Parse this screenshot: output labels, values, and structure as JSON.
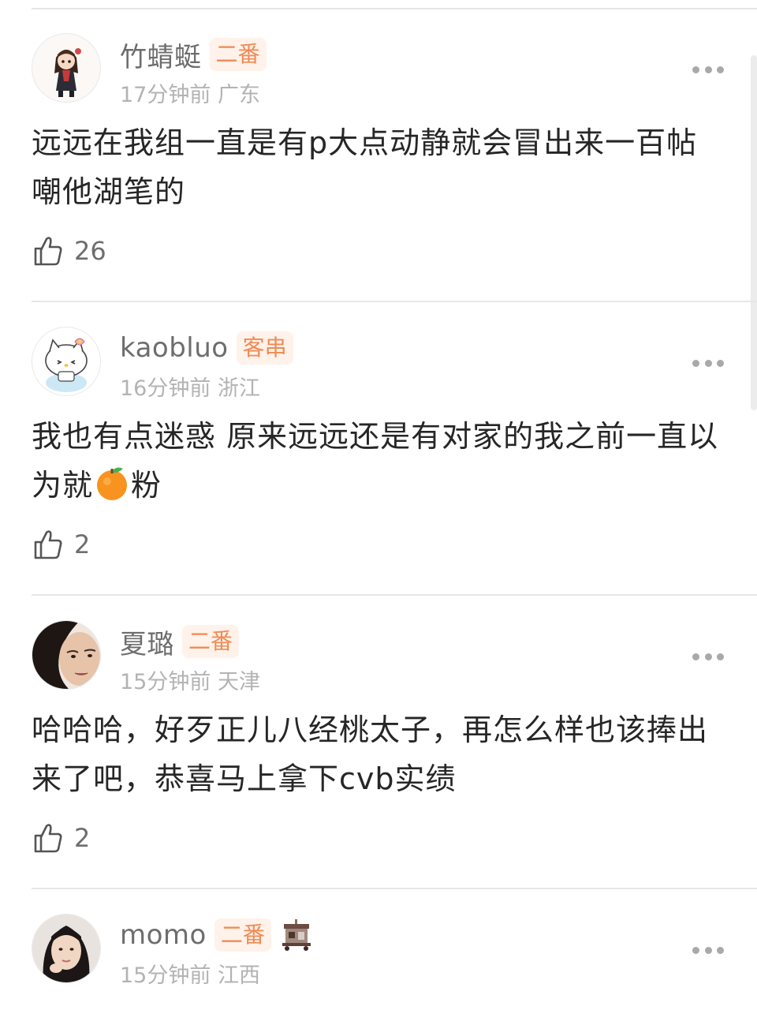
{
  "comments": [
    {
      "username": "竹蜻蜓",
      "badge": "二番",
      "time": "17分钟前",
      "location": "广东",
      "text": "远远在我组一直是有p大点动静就会冒出来一百帖嘲他湖笔的",
      "likes": "26",
      "avatar_icon": "anime-girl-avatar"
    },
    {
      "username": "kaobluo",
      "badge": "客串",
      "time": "16分钟前",
      "location": "浙江",
      "text_before_emoji": "我也有点迷惑 原来远远还是有对家的我之前一直以为就",
      "emoji": "orange-emoji",
      "text_after_emoji": "粉",
      "likes": "2",
      "avatar_icon": "hello-kitty-avatar"
    },
    {
      "username": "夏璐",
      "badge": "二番",
      "time": "15分钟前",
      "location": "天津",
      "text": "哈哈哈，好歹正儿八经桃太子，再怎么样也该捧出来了吧，恭喜马上拿下cvb实绩",
      "likes": "2",
      "avatar_icon": "face-photo-avatar"
    },
    {
      "username": "momo",
      "badge": "二番",
      "time": "15分钟前",
      "location": "江西",
      "sticker_icon": "pixel-shop-sticker",
      "avatar_icon": "girl-photo-avatar"
    }
  ],
  "icons": {
    "like": "thumbs-up-icon",
    "more": "more-dots-icon"
  },
  "colors": {
    "badge_text": "#f08a54",
    "badge_bg": "#fff2ea",
    "username": "#6d6d6d",
    "meta": "#b3b3b3",
    "body": "#262626"
  }
}
